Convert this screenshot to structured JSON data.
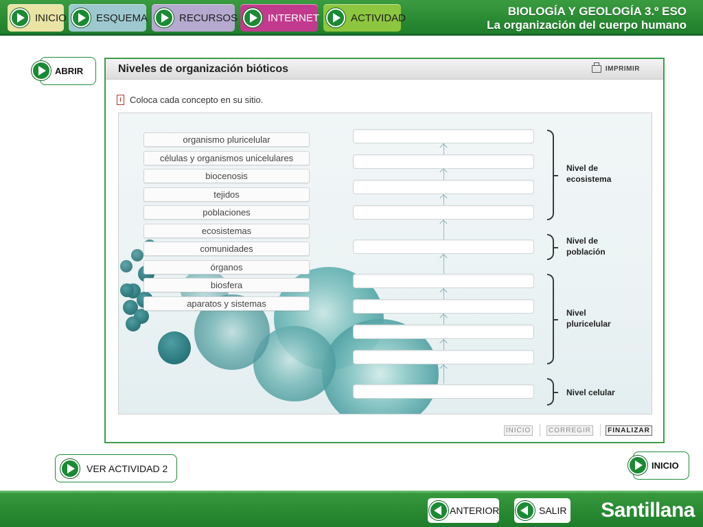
{
  "nav": {
    "items": [
      {
        "label": "INICIO",
        "color": "#e9e3a4"
      },
      {
        "label": "ESQUEMA",
        "color": "#9ec8cf"
      },
      {
        "label": "RECURSOS",
        "color": "#b5a9cf"
      },
      {
        "label": "INTERNET",
        "color": "#c23a8d"
      },
      {
        "label": "ACTIVIDAD",
        "color": "#8dc63f"
      }
    ]
  },
  "header": {
    "subject": "BIOLOGÍA Y GEOLOGÍA 3.º ESO",
    "unit": "La organización del cuerpo humano"
  },
  "side": {
    "abrir": "ABRIR",
    "ver_actividad": "VER ACTIVIDAD 2",
    "inicio": "INICIO"
  },
  "activity": {
    "title": "Niveles de organización bióticos",
    "print_label": "IMPRIMIR",
    "info_icon_text": "i",
    "instruction": "Coloca cada concepto en su sitio.",
    "concepts": [
      "organismo pluricelular",
      "células y organismos unicelulares",
      "biocenosis",
      "tejidos",
      "poblaciones",
      "ecosistemas",
      "comunidades",
      "órganos",
      "biosfera",
      "aparatos y sistemas"
    ],
    "slot_count": 11,
    "levels": [
      {
        "line1": "Nivel de",
        "line2": "ecosistema"
      },
      {
        "line1": "Nivel de",
        "line2": "población"
      },
      {
        "line1": "Nivel",
        "line2": "pluricelular"
      },
      {
        "line1": "Nivel celular",
        "line2": ""
      }
    ],
    "controls": {
      "inicio": "INICIO",
      "corregir": "CORREGIR",
      "finalizar": "FINALIZAR"
    }
  },
  "footer": {
    "anterior": "ANTERIOR",
    "salir": "SALIR",
    "brand": "Santillana"
  }
}
